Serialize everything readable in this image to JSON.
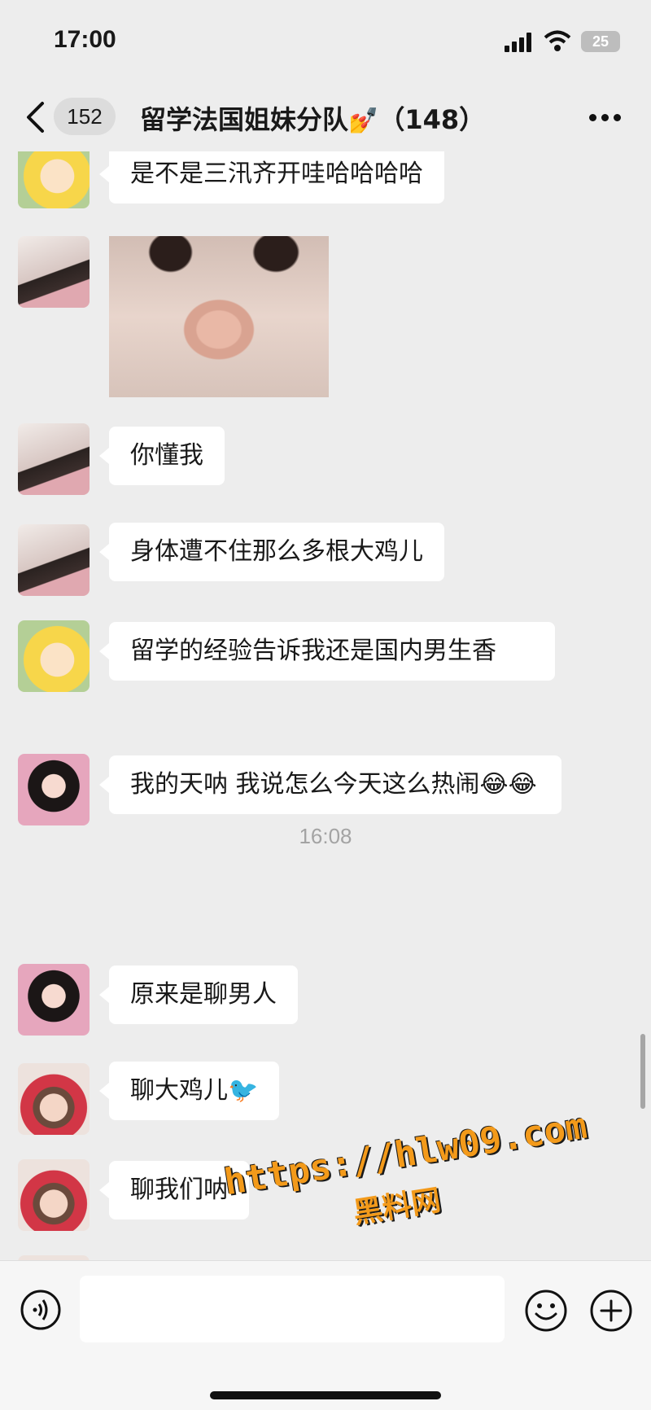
{
  "status_bar": {
    "time": "17:00",
    "battery": "25"
  },
  "header": {
    "back_badge": "152",
    "title": "留学法国姐妹分队",
    "title_emoji": "💅",
    "member_count": "（148）"
  },
  "messages": [
    {
      "sender": "cartoon",
      "text": "是不是三汛齐开哇哈哈哈哈"
    },
    {
      "sender": "girl-a",
      "type": "sticker"
    },
    {
      "sender": "girl-a",
      "text": "你懂我"
    },
    {
      "sender": "girl-a",
      "text": "身体遭不住那么多根大鸡儿"
    },
    {
      "sender": "cartoon",
      "text": "留学的经验告诉我还是国内男生香"
    },
    {
      "sender": "girl-b",
      "text": "我的天呐 我说怎么今天这么热闹😂😂"
    },
    {
      "sender": "girl-b",
      "text": "原来是聊男人"
    },
    {
      "sender": "girl-c",
      "text": "聊大鸡儿🐦"
    },
    {
      "sender": "girl-c",
      "text": "聊我们呐"
    }
  ],
  "timestamp": "16:08",
  "watermark": {
    "url": "https://hlw09.com",
    "name": "黑料网"
  },
  "input_bar": {
    "value": "",
    "placeholder": ""
  },
  "colors": {
    "background": "#ededed",
    "bubble": "#ffffff",
    "watermark": "#f39a1a"
  }
}
